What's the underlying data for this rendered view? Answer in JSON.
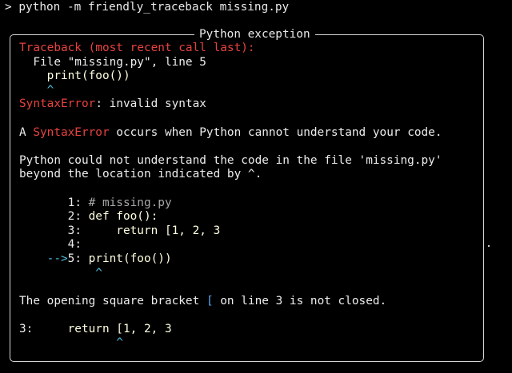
{
  "command": "> python -m friendly_traceback missing.py",
  "panel_title": "Python exception",
  "traceback_header": "Traceback (most recent call last):",
  "file_line": "  File \"missing.py\", line 5",
  "code_line": "    print(foo())",
  "caret_line": "    ^",
  "error_type": "SyntaxError",
  "error_message": ": invalid syntax",
  "explanation_prefix": "A ",
  "explanation_error": "SyntaxError",
  "explanation_suffix": " occurs when Python cannot understand your code.",
  "location_line1": "Python could not understand the code in the file 'missing.py'",
  "location_line2": "beyond the location indicated by ^.",
  "source_lines": [
    {
      "num": "       1",
      "arrow": "",
      "sep": ": ",
      "code": "# missing.py",
      "is_comment": true
    },
    {
      "num": "       2",
      "arrow": "",
      "sep": ": ",
      "code": "def foo():",
      "is_comment": false
    },
    {
      "num": "       3",
      "arrow": "",
      "sep": ": ",
      "code": "    return [1, 2, 3",
      "is_comment": false
    },
    {
      "num": "       4",
      "arrow": "",
      "sep": ":",
      "code": "",
      "is_comment": false
    },
    {
      "num": "5",
      "arrow": "    -->",
      "sep": ": ",
      "code": "print(foo())",
      "is_comment": false
    }
  ],
  "source_caret": "           ^",
  "hint_prefix": "The opening square bracket ",
  "hint_bracket": "[",
  "hint_suffix": " on line 3 is not closed.",
  "final_line_num": "3:",
  "final_code": "     return [1, 2, 3",
  "final_caret": "              ^",
  "colors": {
    "error_red": "#e8423f",
    "code_yellow": "#ffffe0",
    "caret_cyan": "#4fc2e0",
    "bracket_blue": "#5ea6f5"
  }
}
